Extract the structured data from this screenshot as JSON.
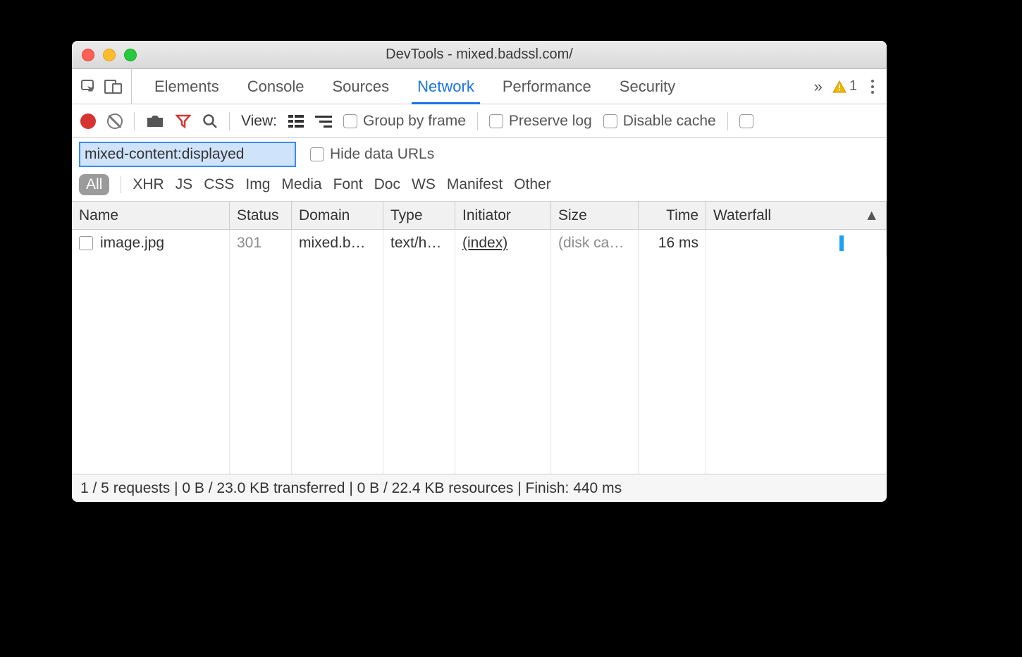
{
  "window": {
    "title": "DevTools - mixed.badssl.com/"
  },
  "tabs": {
    "items": [
      "Elements",
      "Console",
      "Sources",
      "Network",
      "Performance",
      "Security"
    ],
    "active": "Network",
    "overflow": "»",
    "warning_count": "1"
  },
  "toolbar": {
    "view_label": "View:",
    "group_by_frame": "Group by frame",
    "preserve_log": "Preserve log",
    "disable_cache": "Disable cache"
  },
  "filter": {
    "value": "mixed-content:displayed",
    "hide_data_urls": "Hide data URLs"
  },
  "types": {
    "all": "All",
    "items": [
      "XHR",
      "JS",
      "CSS",
      "Img",
      "Media",
      "Font",
      "Doc",
      "WS",
      "Manifest",
      "Other"
    ]
  },
  "columns": {
    "name": "Name",
    "status": "Status",
    "domain": "Domain",
    "type": "Type",
    "initiator": "Initiator",
    "size": "Size",
    "time": "Time",
    "waterfall": "Waterfall",
    "sort_indicator": "▲"
  },
  "rows": [
    {
      "name": "image.jpg",
      "status": "301",
      "domain": "mixed.b…",
      "type": "text/h…",
      "initiator": "(index)",
      "size": "(disk ca…",
      "time": "16 ms"
    }
  ],
  "status": "1 / 5 requests | 0 B / 23.0 KB transferred | 0 B / 22.4 KB resources | Finish: 440 ms"
}
